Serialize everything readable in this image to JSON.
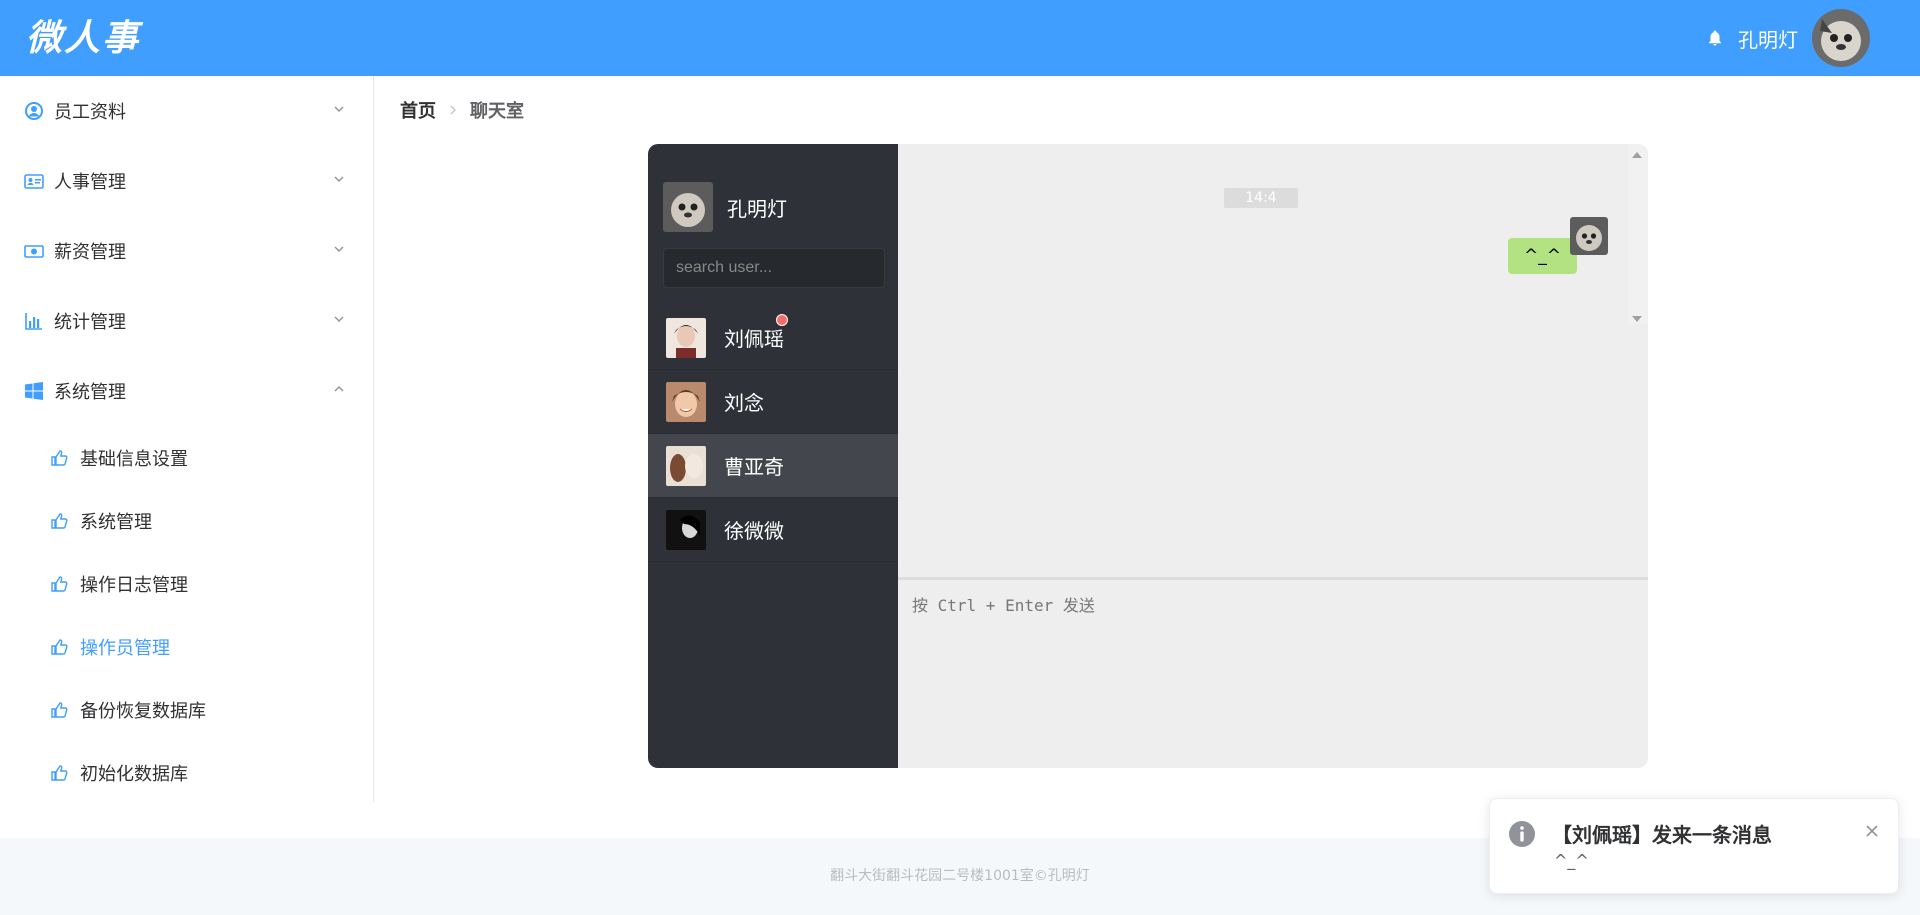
{
  "header": {
    "logo_text": "微人事",
    "username": "孔明灯"
  },
  "sidebar": {
    "items": [
      {
        "label": "员工资料",
        "icon": "user-circle-icon",
        "expanded": false
      },
      {
        "label": "人事管理",
        "icon": "id-card-icon",
        "expanded": false
      },
      {
        "label": "薪资管理",
        "icon": "money-icon",
        "expanded": false
      },
      {
        "label": "统计管理",
        "icon": "bar-chart-icon",
        "expanded": false
      },
      {
        "label": "系统管理",
        "icon": "windows-icon",
        "expanded": true
      }
    ],
    "sub_items": [
      {
        "label": "基础信息设置"
      },
      {
        "label": "系统管理"
      },
      {
        "label": "操作日志管理"
      },
      {
        "label": "操作员管理",
        "active": true
      },
      {
        "label": "备份恢复数据库"
      },
      {
        "label": "初始化数据库"
      }
    ]
  },
  "breadcrumb": {
    "home": "首页",
    "current": "聊天室"
  },
  "chat": {
    "me_name": "孔明灯",
    "search_placeholder": "search user...",
    "users": [
      {
        "name": "刘佩瑶",
        "unread": true
      },
      {
        "name": "刘念",
        "unread": false
      },
      {
        "name": "曹亚奇",
        "unread": false,
        "active": true
      },
      {
        "name": "徐微微",
        "unread": false
      }
    ],
    "time": "14:4",
    "message": "^_^",
    "input_placeholder": "按 Ctrl + Enter 发送"
  },
  "footer": {
    "text": "翻斗大街翻斗花园二号楼1001室©孔明灯"
  },
  "notification": {
    "title": "【刘佩瑶】发来一条消息",
    "body": "^_^"
  },
  "colors": {
    "primary": "#409eff",
    "chat_sidebar": "#2e3238",
    "bubble": "#b2e281",
    "unread_dot": "#f56c6c"
  }
}
